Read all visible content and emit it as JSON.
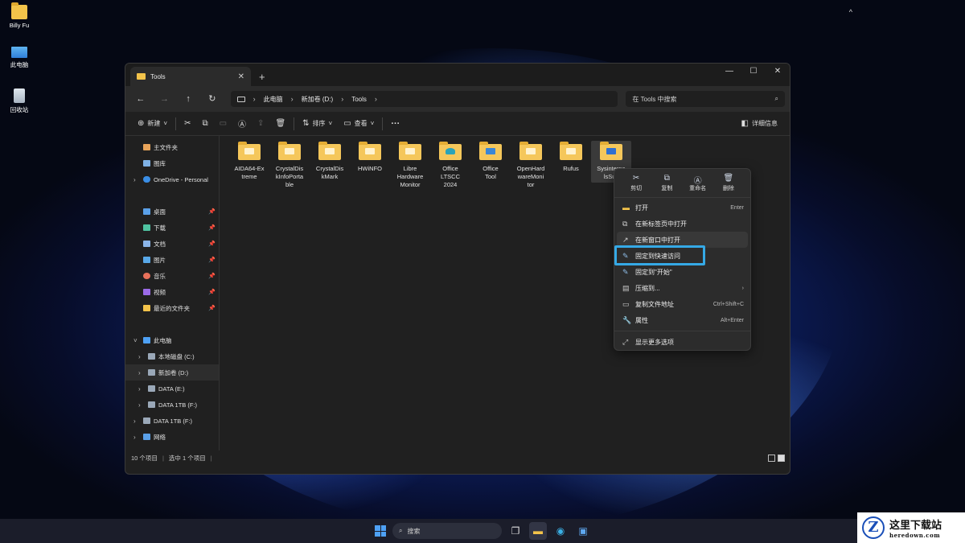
{
  "desktop": {
    "icons": [
      {
        "label": "Billy Fu",
        "icon": "folder-icon"
      },
      {
        "label": "此电脑",
        "icon": "computer-icon"
      },
      {
        "label": "回收站",
        "icon": "recycle-bin-icon"
      }
    ]
  },
  "window": {
    "tab_title": "Tools",
    "controls": {
      "minimize": "—",
      "maximize": "☐",
      "close": "✕"
    }
  },
  "navbar": {
    "breadcrumb": [
      "此电脑",
      "新加卷 (D:)",
      "Tools"
    ],
    "search_placeholder": "在 Tools 中搜索"
  },
  "cmdbar": {
    "new_label": "新建",
    "sort_label": "排序",
    "view_label": "查看",
    "more_label": "···",
    "details_label": "详细信息"
  },
  "sidebar": {
    "top": [
      {
        "label": "主文件夹",
        "color": "#e8a45a"
      },
      {
        "label": "图库",
        "color": "#7fb2e6"
      },
      {
        "label": "OneDrive - Personal",
        "color": "#3a8ee6",
        "chevron": true
      }
    ],
    "pinned": [
      {
        "label": "桌面",
        "color": "#5aa0e8"
      },
      {
        "label": "下载",
        "color": "#4fc3a1"
      },
      {
        "label": "文档",
        "color": "#8ab4e8"
      },
      {
        "label": "图片",
        "color": "#58a8e8"
      },
      {
        "label": "音乐",
        "color": "#e8705a"
      },
      {
        "label": "视频",
        "color": "#9b6be8"
      },
      {
        "label": "最近的文件夹",
        "color": "#f3c34a"
      }
    ],
    "pc": [
      {
        "label": "此电脑",
        "color": "#4ea1f5",
        "expanded": true
      },
      {
        "label": "本地磁盘 (C:)",
        "color": "#9aa8b8",
        "indent": true
      },
      {
        "label": "新加卷 (D:)",
        "color": "#9aa8b8",
        "indent": true,
        "selected": true
      },
      {
        "label": "DATA (E:)",
        "color": "#9aa8b8",
        "indent": true
      },
      {
        "label": "DATA 1TB (F:)",
        "color": "#9aa8b8",
        "indent": true
      },
      {
        "label": "DATA 1TB (F:)",
        "color": "#9aa8b8"
      },
      {
        "label": "网络",
        "color": "#5aa0e8"
      }
    ]
  },
  "files": [
    {
      "name": "AIDA64-Extreme",
      "l1": "AIDA64-Ex",
      "l2": "treme",
      "l3": ""
    },
    {
      "name": "CrystalDiskInfoPortable",
      "l1": "CrystalDis",
      "l2": "kInfoPorta",
      "l3": "ble"
    },
    {
      "name": "CrystalDiskMark",
      "l1": "CrystalDis",
      "l2": "kMark",
      "l3": ""
    },
    {
      "name": "HWiNFO",
      "l1": "HWiNFO",
      "l2": "",
      "l3": ""
    },
    {
      "name": "Libre Hardware Monitor",
      "l1": "Libre",
      "l2": "Hardware",
      "l3": "Monitor"
    },
    {
      "name": "Office LTSCC 2024",
      "l1": "Office",
      "l2": "LTSCC",
      "l3": "2024"
    },
    {
      "name": "Office Tool",
      "l1": "Office",
      "l2": "Tool",
      "l3": ""
    },
    {
      "name": "OpenHardwareMonitor",
      "l1": "OpenHard",
      "l2": "wareMoni",
      "l3": "tor"
    },
    {
      "name": "Rufus",
      "l1": "Rufus",
      "l2": "",
      "l3": ""
    },
    {
      "name": "SysinternalsSuite",
      "l1": "Sysinterna",
      "l2": "lsSuit",
      "l3": ""
    }
  ],
  "status": {
    "count": "10 个项目",
    "selected": "选中 1 个项目"
  },
  "context_menu": {
    "quick_actions": [
      {
        "label": "剪切",
        "icon": "✂"
      },
      {
        "label": "复制",
        "icon": "⧉"
      },
      {
        "label": "重命名",
        "icon": "Ⓐ"
      },
      {
        "label": "删除",
        "icon": "🗑"
      }
    ],
    "items": [
      {
        "label": "打开",
        "shortcut": "Enter"
      },
      {
        "label": "在新标签页中打开",
        "shortcut": ""
      },
      {
        "label": "在新窗口中打开",
        "shortcut": ""
      },
      {
        "label": "固定到快速访问",
        "shortcut": ""
      },
      {
        "label": "固定到\"开始\"",
        "shortcut": ""
      },
      {
        "label": "压缩到...",
        "shortcut": "›"
      },
      {
        "label": "复制文件地址",
        "shortcut": "Ctrl+Shift+C"
      },
      {
        "label": "属性",
        "shortcut": "Alt+Enter"
      },
      {
        "label": "显示更多选项",
        "shortcut": ""
      }
    ]
  },
  "taskbar": {
    "search_label": "搜索",
    "overflow": "^"
  },
  "watermark": {
    "logo_letter": "Z",
    "title": "这里下载站",
    "domain": "heredown.com"
  },
  "colors": {
    "accent": "#35a9e6",
    "folder": "#f5c75b"
  }
}
